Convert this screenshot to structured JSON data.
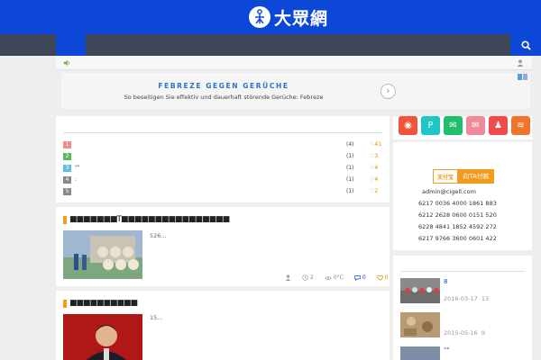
{
  "header": {
    "logo_text": "大眾網",
    "logo_alt": "logo"
  },
  "nav": {
    "search_icon": "search-icon"
  },
  "notice": {
    "speaker_icon": "volume-icon",
    "user_icon": "user-icon"
  },
  "ad": {
    "title": "FEBREZE GEGEN GERÜCHE",
    "subtitle": "So beseitigen Sie effektiv und dauerhaft störende Gerüche: Febreze",
    "arrow": "›"
  },
  "ranking": {
    "rows": [
      {
        "num": "1",
        "title": "",
        "count": "(4)",
        "likes": "41",
        "color": "#f28b8b"
      },
      {
        "num": "2",
        "title": "",
        "count": "(1)",
        "likes": "3",
        "color": "#5cb85c"
      },
      {
        "num": "3",
        "title": "\"\"",
        "count": "(1)",
        "likes": "4",
        "color": "#5bc0de"
      },
      {
        "num": "4",
        "title": ":",
        "count": "(1)",
        "likes": "4",
        "color": "#888888"
      },
      {
        "num": "5",
        "title": "",
        "count": "(1)",
        "likes": "2",
        "color": "#888888"
      }
    ]
  },
  "posts": [
    {
      "title": "■■■■■■■T■■■■■■■■■■■■■■■■",
      "excerpt": "526...",
      "meta": {
        "comments": "2",
        "views": "0°C",
        "replies": "0",
        "likes": "0"
      }
    },
    {
      "title": "■■■■■■■■■■",
      "excerpt": "15..."
    }
  ],
  "sidebar": {
    "social": [
      {
        "name": "weibo-icon",
        "color": "#f0543c",
        "glyph": "◉"
      },
      {
        "name": "p-icon",
        "color": "#1ec6c6",
        "glyph": "P"
      },
      {
        "name": "wechat-icon",
        "color": "#1fbf6b",
        "glyph": "✉"
      },
      {
        "name": "mail-icon",
        "color": "#f08a9a",
        "glyph": "✉"
      },
      {
        "name": "qq-icon",
        "color": "#f04a4a",
        "glyph": "♟"
      },
      {
        "name": "rss-icon",
        "color": "#f0742c",
        "glyph": "≋"
      }
    ],
    "pay": {
      "left": "支付宝",
      "right": "向TA付款"
    },
    "email": "admin@cigell.com",
    "accounts": [
      "6217 0036 4000 1861 883",
      "6212 2628 0600 0151 520",
      "6228 4841 1852 4592 272",
      "6217 9766 3600 0601 422"
    ],
    "recent": [
      {
        "title": "8",
        "date": "2016-03-17",
        "count": "13"
      },
      {
        "title": "",
        "date": "2015-05-16",
        "count": "9"
      },
      {
        "title": "\"\"",
        "date": "",
        "count": ""
      }
    ]
  }
}
